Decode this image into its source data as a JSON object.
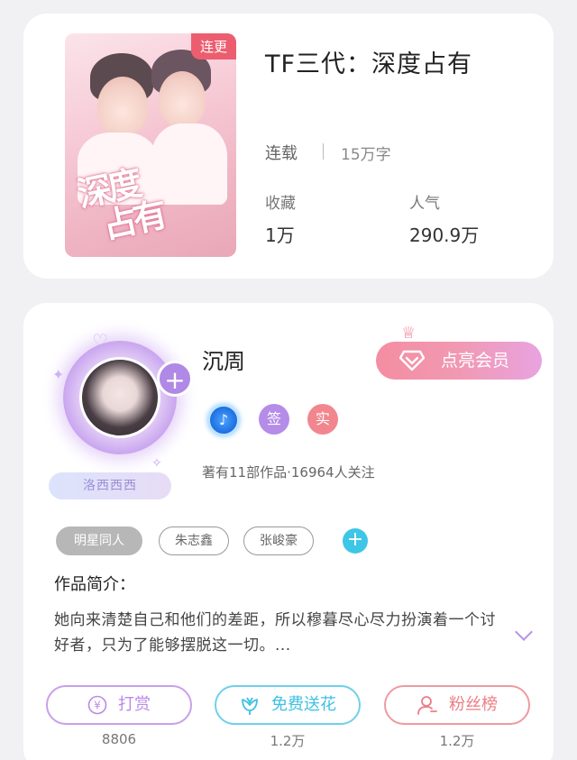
{
  "book": {
    "serial_badge": "连更",
    "cover_title_line1": "深度",
    "cover_title_line2": "占有",
    "title": "TF三代：深度占有",
    "status": "连载",
    "word_count": "15万字",
    "favorites_label": "收藏",
    "favorites_value": "1万",
    "popularity_label": "人气",
    "popularity_value": "290.9万"
  },
  "author": {
    "avatar_tag": "洛西西西",
    "name": "沉周",
    "vip_button": "点亮会员",
    "sign_badge": "签",
    "real_badge": "实",
    "stats": "著有11部作品·16964人关注",
    "tags": [
      "明星同人",
      "朱志鑫",
      "张峻豪"
    ],
    "intro_label": "作品简介：",
    "intro_text": "她向来清楚自己和他们的差距，所以穆暮尽心尽力扮演着一个讨好者，只为了能够摆脱这一切。..."
  },
  "actions": {
    "reward_label": "打赏",
    "reward_count": "8806",
    "flower_label": "免费送花",
    "flower_count": "1.2万",
    "fans_label": "粉丝榜",
    "fans_count": "1.2万"
  },
  "colors": {
    "reward": "#b98be6",
    "flower": "#3fc0e3",
    "fans": "#ec7d86"
  }
}
